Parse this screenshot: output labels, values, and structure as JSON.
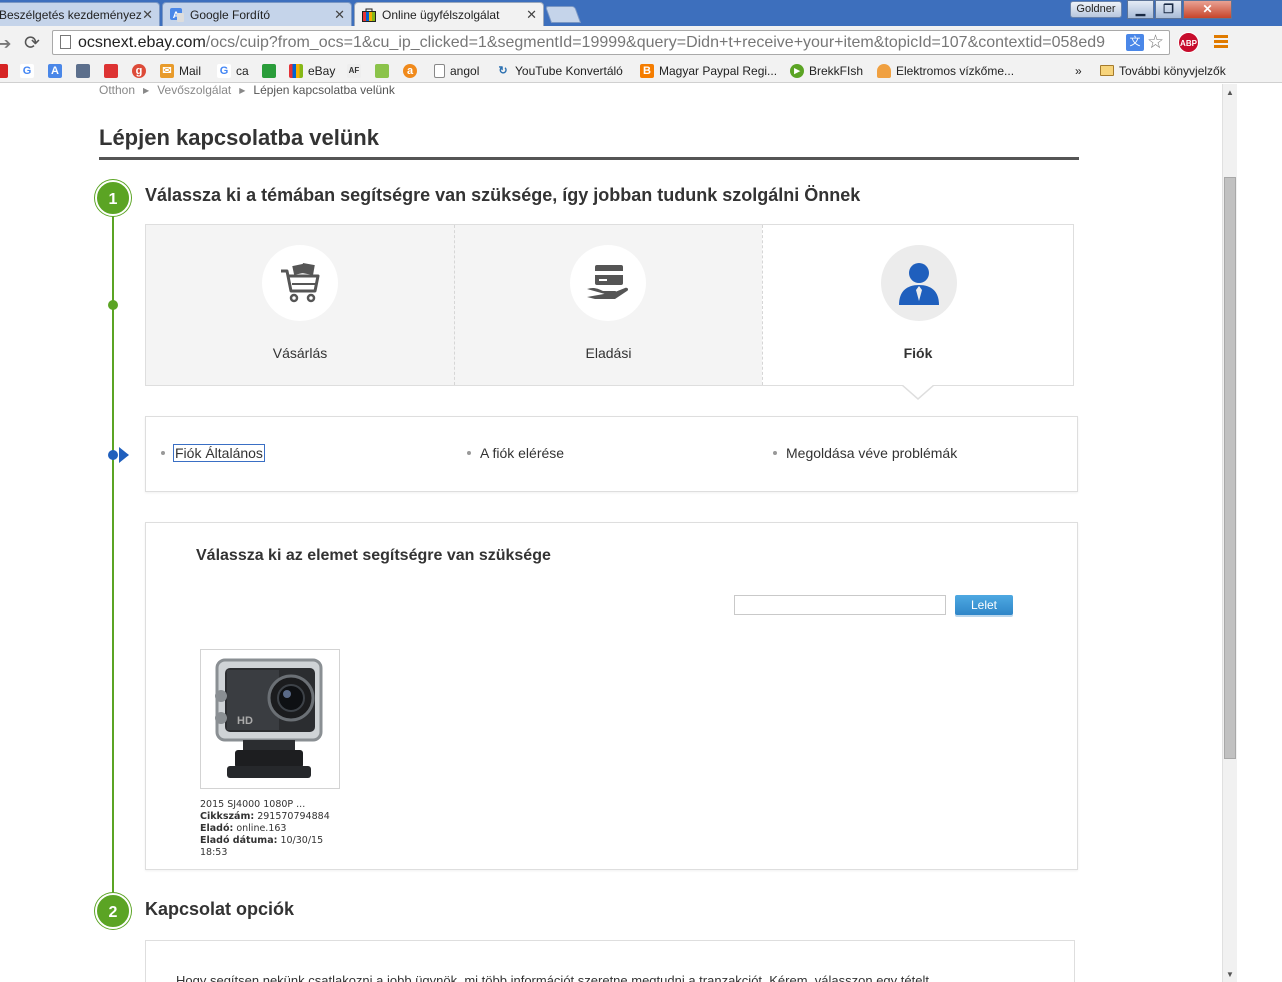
{
  "browser": {
    "tabs": [
      {
        "label": "Beszélgetés kezdeményez",
        "active": false
      },
      {
        "label": "Google Fordító",
        "active": false
      },
      {
        "label": "Online ügyfélszolgálat",
        "active": true
      }
    ],
    "profile_name": "Goldner",
    "url_host": "ocsnext.ebay.com",
    "url_rest": "/ocs/cuip?from_ocs=1&cu_ip_clicked=1&segmentId=19999&query=Didn+t+receive+your+item&topicId=107&contextid=058ed9",
    "translate_glyph": "文",
    "abp_label": "ABP",
    "bookmarks": {
      "mail": "Mail",
      "ca": "ca",
      "ebay": "eBay",
      "angol": "angol",
      "youtube": "YouTube Konvertáló",
      "paypal": "Magyar Paypal Regi...",
      "brekk": "BrekkFIsh",
      "elektromos": "Elektromos vízkőme...",
      "overflow": "»",
      "more_folder": "További könyvjelzők"
    }
  },
  "page": {
    "breadcrumb": [
      "Otthon",
      "Vevőszolgálat",
      "Lépjen kapcsolatba velünk"
    ],
    "title": "Lépjen kapcsolatba velünk",
    "step1": {
      "number": "1",
      "heading": "Válassza ki a témában segítségre van szüksége, így jobban tudunk szolgálni Önnek",
      "categories": [
        {
          "label": "Vásárlás",
          "icon": "shopping-cart-icon",
          "selected": false
        },
        {
          "label": "Eladási",
          "icon": "card-hand-icon",
          "selected": false
        },
        {
          "label": "Fiók",
          "icon": "user-icon",
          "selected": true
        }
      ],
      "subtopics": [
        {
          "label": "Fiók Általános",
          "focused": true
        },
        {
          "label": "A fiók elérése",
          "focused": false
        },
        {
          "label": "Megoldása véve problémák",
          "focused": false
        }
      ]
    },
    "item_select": {
      "heading": "Válassza ki az elemet segítségre van szüksége",
      "search_value": "",
      "find_label": "Lelet",
      "item": {
        "title": "2015 SJ4000 1080P ...",
        "item_no_label": "Cikkszám:",
        "item_no": "291570794884",
        "seller_label": "Eladó:",
        "seller": "online.163",
        "date_label": "Eladó dátuma:",
        "date": "10/30/15 18:53"
      }
    },
    "step2": {
      "number": "2",
      "heading": "Kapcsolat opciók",
      "intro": "Hogy segítsen nekünk csatlakozni a jobb ügynök, mi több információt szeretne megtudni a tranzakciót. Kérem, válasszon egy tételt."
    }
  },
  "colors": {
    "step_green": "#5ba424",
    "selected_blue": "#1f5fbd",
    "button_blue": "#2f86c8"
  }
}
